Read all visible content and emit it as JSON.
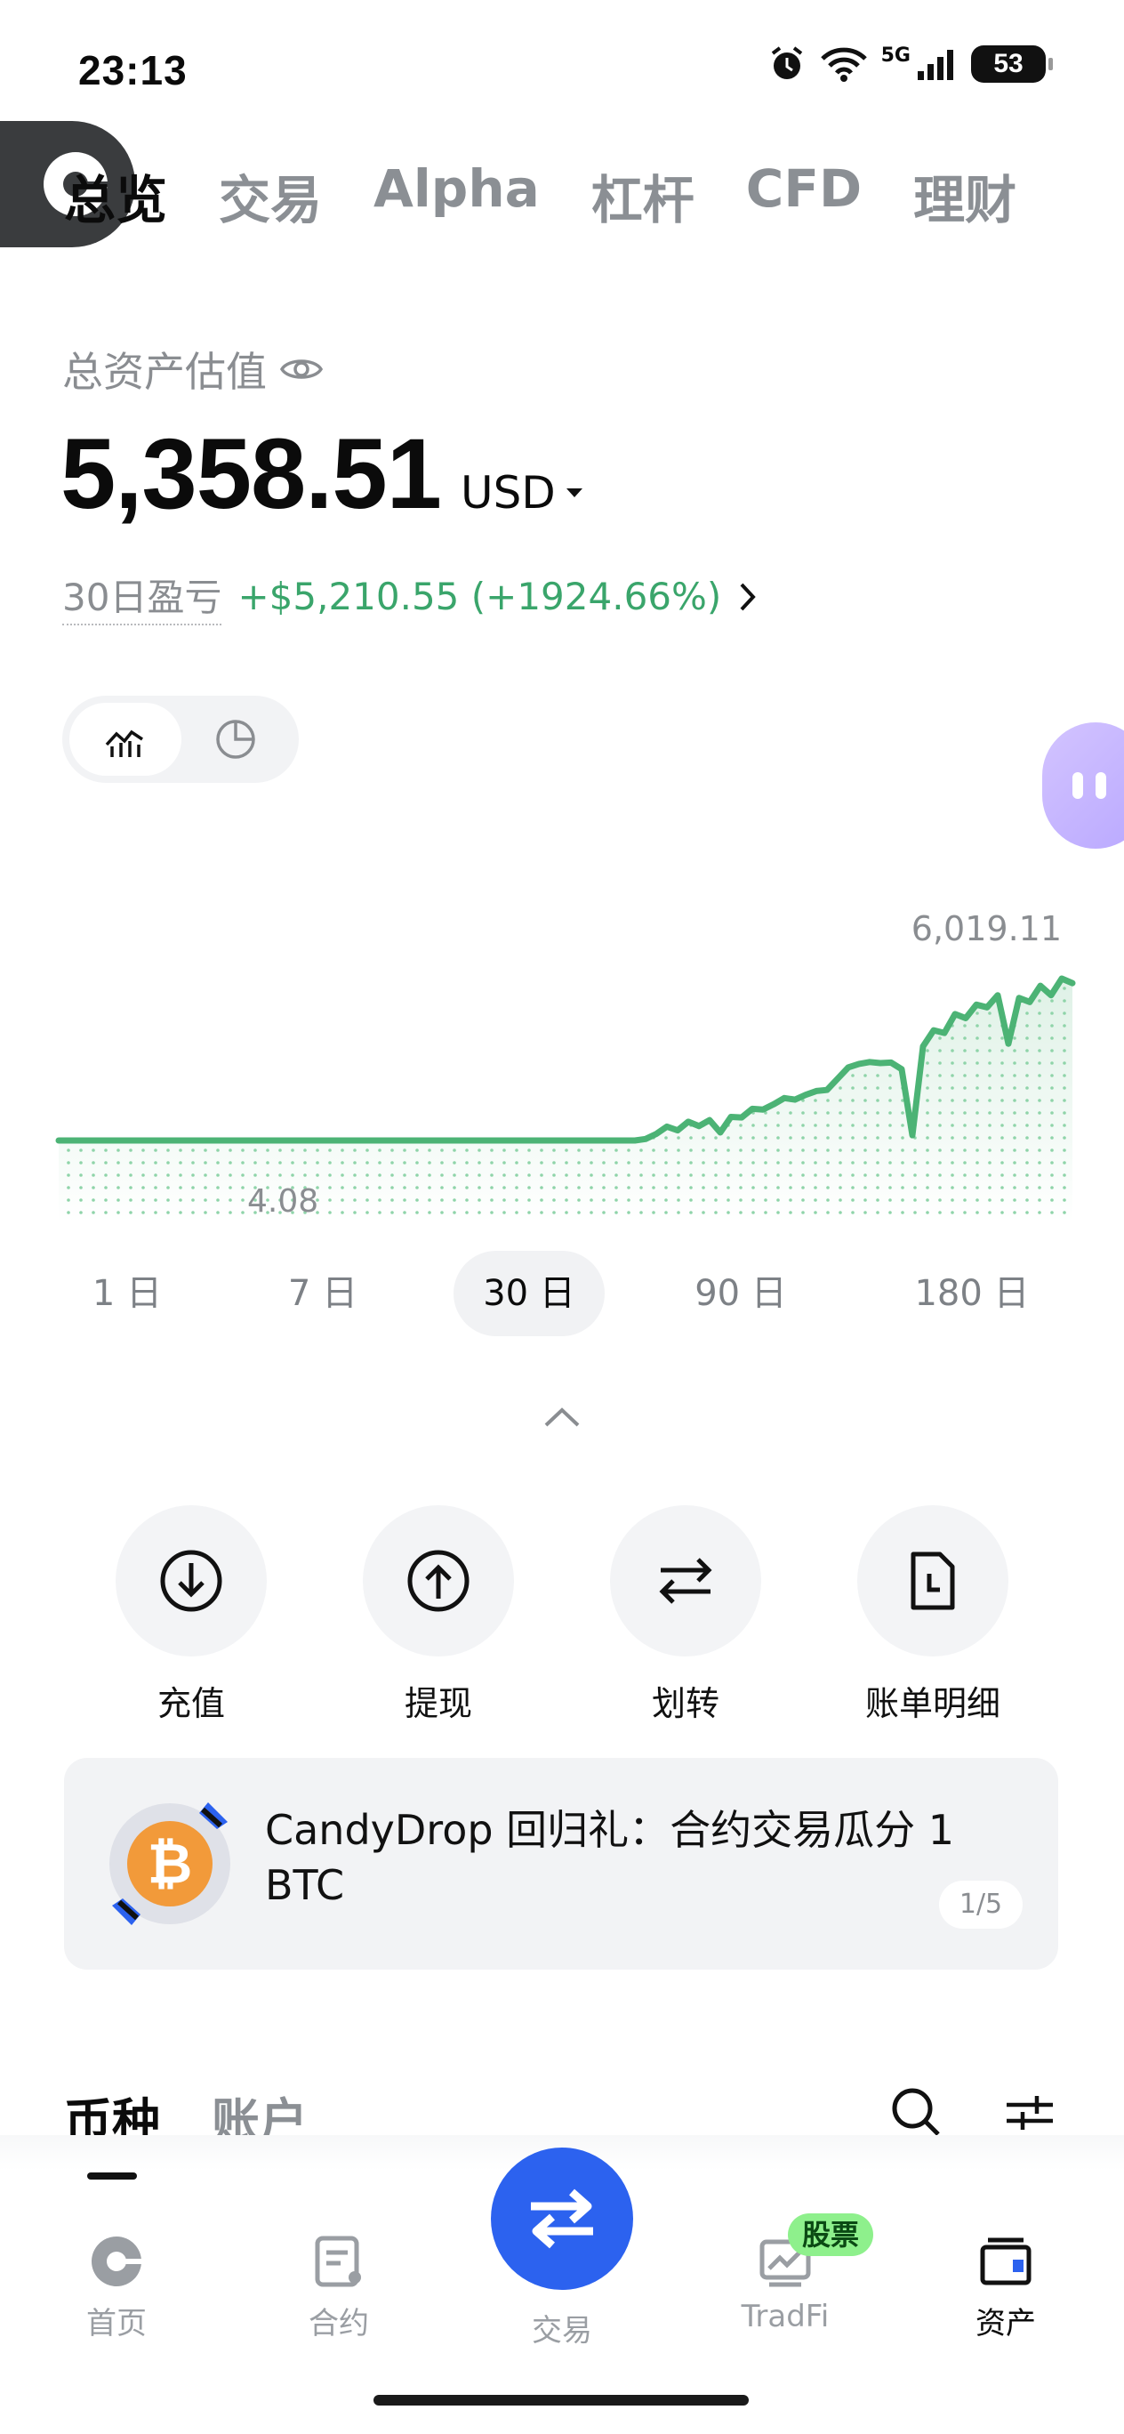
{
  "status": {
    "time": "23:13",
    "network": "5G",
    "battery": "53"
  },
  "top_tabs": [
    "总览",
    "交易",
    "Alpha",
    "杠杆",
    "CFD",
    "理财"
  ],
  "summary": {
    "label": "总资产估值",
    "value": "5,358.51",
    "currency": "USD",
    "pnl_label": "30日盈亏",
    "pnl_value": "+$5,210.55 (+1924.66%)"
  },
  "chart_data": {
    "type": "area",
    "max_label": "6,019.11",
    "min_label": "4.08",
    "series": [
      {
        "values": [
          4.08,
          4.08,
          4.08,
          4.08,
          4.08,
          4.08,
          4.08,
          4.08,
          4.08,
          4.08,
          4.08,
          4.08,
          4.08,
          4.08,
          4.08,
          4.08,
          4.08,
          4.08,
          4.08,
          4.08,
          4.08,
          4.08,
          4.08,
          4.08,
          4.08,
          4.08,
          4.08,
          4.08,
          4.08,
          4.08,
          4.08,
          4.08,
          4.08,
          4.08,
          4.08,
          4.08,
          4.08,
          4.08,
          4.08,
          4.08,
          4.08,
          4.08,
          4.08,
          4.08,
          4.08,
          4.08,
          4.08,
          4.08,
          4.08,
          4.08,
          4.08,
          4.08,
          4.08,
          4.08,
          4.08,
          60,
          250,
          520,
          380,
          700,
          540,
          760,
          300,
          880,
          860,
          1180,
          1150,
          1350,
          1580,
          1520,
          1700,
          1840,
          1880,
          2300,
          2720,
          2850,
          2920,
          2880,
          2900,
          2650,
          200,
          3500,
          4100,
          4000,
          4700,
          4550,
          5050,
          4950,
          5400,
          3600,
          5300,
          5150,
          5750,
          5400,
          6019.11,
          5850
        ]
      }
    ],
    "grid": false
  },
  "ranges": [
    "1 日",
    "7 日",
    "30 日",
    "90 日",
    "180 日"
  ],
  "active_range": "30 日",
  "actions": [
    "充值",
    "提现",
    "划转",
    "账单明细"
  ],
  "banner": {
    "text": "CandyDrop 回归礼：合约交易瓜分 1 BTC",
    "page": "1/5"
  },
  "list_tabs": [
    "币种",
    "账户"
  ],
  "bottom_nav": [
    "首页",
    "合约",
    "交易",
    "TradFi",
    "资产"
  ],
  "nav_badge": "股票",
  "colors": {
    "positive": "#3aa56b",
    "chart_line": "#4cb375",
    "accent": "#2c62ef",
    "badge": "#8ef08c"
  }
}
